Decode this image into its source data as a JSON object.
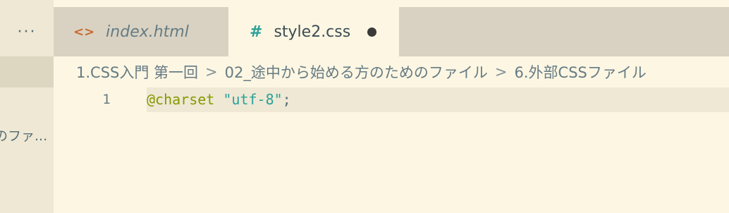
{
  "sidebar": {
    "more_label": "···",
    "file_item_label": "のファ..."
  },
  "tabs": [
    {
      "label": "index.html",
      "icon": "html-code-icon",
      "active": false
    },
    {
      "label": "style2.css",
      "icon": "css-hash-icon",
      "active": true,
      "dirty": true
    }
  ],
  "tab_icons": {
    "html": "<>",
    "css": "#"
  },
  "breadcrumb": {
    "items": [
      "1.CSS入門 第一回",
      "02_途中から始める方のためのファイル",
      "6.外部CSSファイル"
    ],
    "separator": ">"
  },
  "editor": {
    "line_number": "1",
    "tokens": {
      "at_rule": "@charset",
      "space": " ",
      "string": "\"utf-8\"",
      "punct": ";"
    }
  },
  "colors": {
    "background": "#fdf6e3",
    "sidebar": "#eee8d5",
    "tabbar": "#d9d2c2",
    "at_rule": "#859900",
    "string": "#2aa198",
    "html_icon": "#cb6a2e"
  }
}
